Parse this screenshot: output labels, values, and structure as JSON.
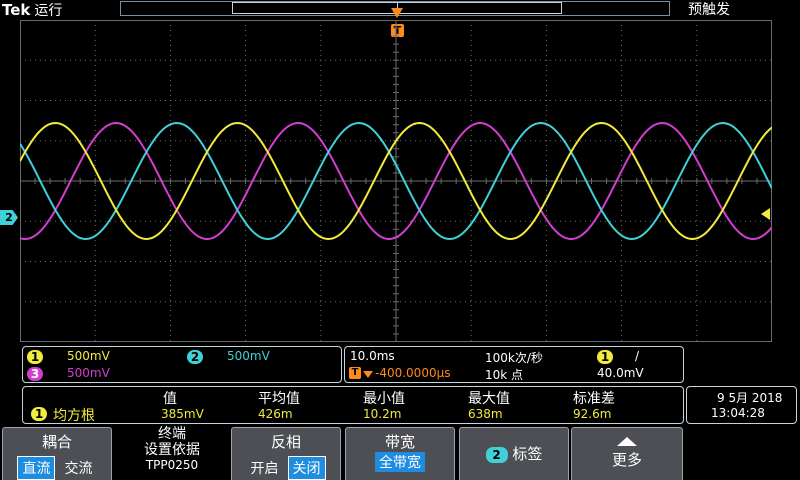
{
  "header": {
    "brand": "Tek",
    "run_status": "运行",
    "trigger_status": "预触发",
    "trigger_marker": "T"
  },
  "channels": [
    {
      "id": "1",
      "scale": "500mV",
      "color": "#f2ea3c"
    },
    {
      "id": "2",
      "scale": "500mV",
      "color": "#3fd0d8"
    },
    {
      "id": "3",
      "scale": "500mV",
      "color": "#d13ed0"
    }
  ],
  "ground_marker": "2",
  "timebase": {
    "scale": "10.0ms",
    "sample_rate": "100k次/秒",
    "position": "-400.0000μs",
    "record_length": "10k 点",
    "trigger_source": "1",
    "trigger_slope": "/",
    "trigger_level": "40.0mV",
    "trigger_icon": "T"
  },
  "measurements": {
    "headers": [
      "值",
      "平均值",
      "最小值",
      "最大值",
      "标准差"
    ],
    "source": "1",
    "label": "均方根",
    "values": [
      "385mV",
      "426m",
      "10.2m",
      "638m",
      "92.6m"
    ]
  },
  "datetime": {
    "date": "9 5月 2018",
    "time": "13:04:28"
  },
  "softkeys": {
    "coupling": {
      "title": "耦合",
      "opt_dc": "直流",
      "opt_ac": "交流"
    },
    "termination": {
      "line1": "终端",
      "line2": "设置依据",
      "line3": "TPP0250"
    },
    "invert": {
      "title": "反相",
      "opt_on": "开启",
      "opt_off": "关闭"
    },
    "bandwidth": {
      "title": "带宽",
      "value": "全带宽"
    },
    "label": {
      "channel": "2",
      "title": "标签"
    },
    "more": {
      "title": "更多"
    }
  },
  "icons": {
    "more": "chevron-up-icon",
    "trigger_level": "arrow-left-icon"
  },
  "colors": {
    "graticule": "#6b6b6b",
    "trigger_orange": "#ff8a1a",
    "accent_blue": "#1e8ce0"
  }
}
